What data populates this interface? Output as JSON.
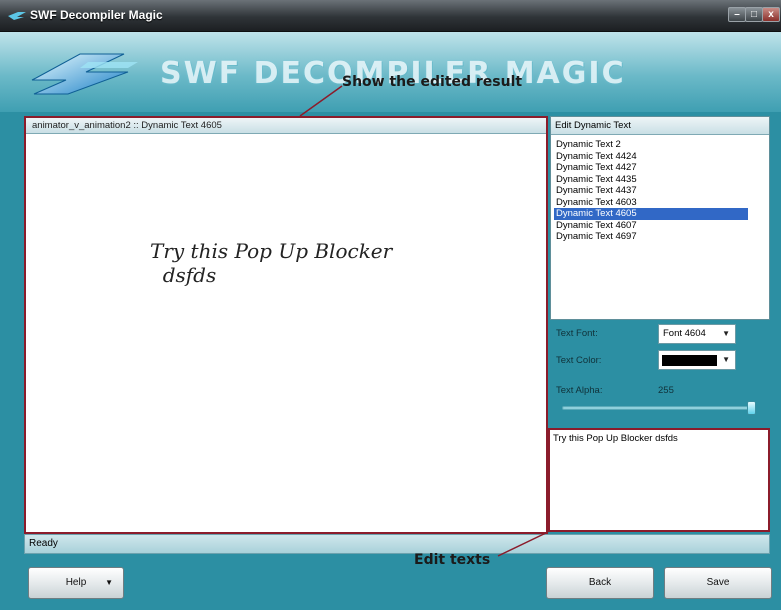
{
  "window": {
    "title": "SWF Decompiler Magic"
  },
  "header": {
    "brand": "SWF DECOMPILER MAGIC"
  },
  "annotations": {
    "show_result": "Show the edited result",
    "edit_texts": "Edit texts"
  },
  "preview": {
    "title": "animator_v_animation2 :: Dynamic Text 4605",
    "content_line1": "Try this Pop Up Blocker",
    "content_line2": "  dsfds"
  },
  "edit_panel": {
    "title": "Edit Dynamic Text",
    "items": [
      "Dynamic Text 2",
      "Dynamic Text 4424",
      "Dynamic Text 4427",
      "Dynamic Text 4435",
      "Dynamic Text 4437",
      "Dynamic Text 4603",
      "Dynamic Text 4605",
      "Dynamic Text 4607",
      "Dynamic Text 4697"
    ],
    "selected_index": 6
  },
  "properties": {
    "font_label": "Text Font:",
    "font_value": "Font 4604",
    "color_label": "Text Color:",
    "color_value": "#000000",
    "alpha_label": "Text Alpha:",
    "alpha_value": "255"
  },
  "text_edit": {
    "value": "Try this Pop Up Blocker  dsfds"
  },
  "status": {
    "text": "Ready"
  },
  "buttons": {
    "help": "Help",
    "back": "Back",
    "save": "Save"
  },
  "colors": {
    "accent": "#2c8fa3",
    "highlight": "#8b1c2b",
    "selection": "#3168c6"
  }
}
